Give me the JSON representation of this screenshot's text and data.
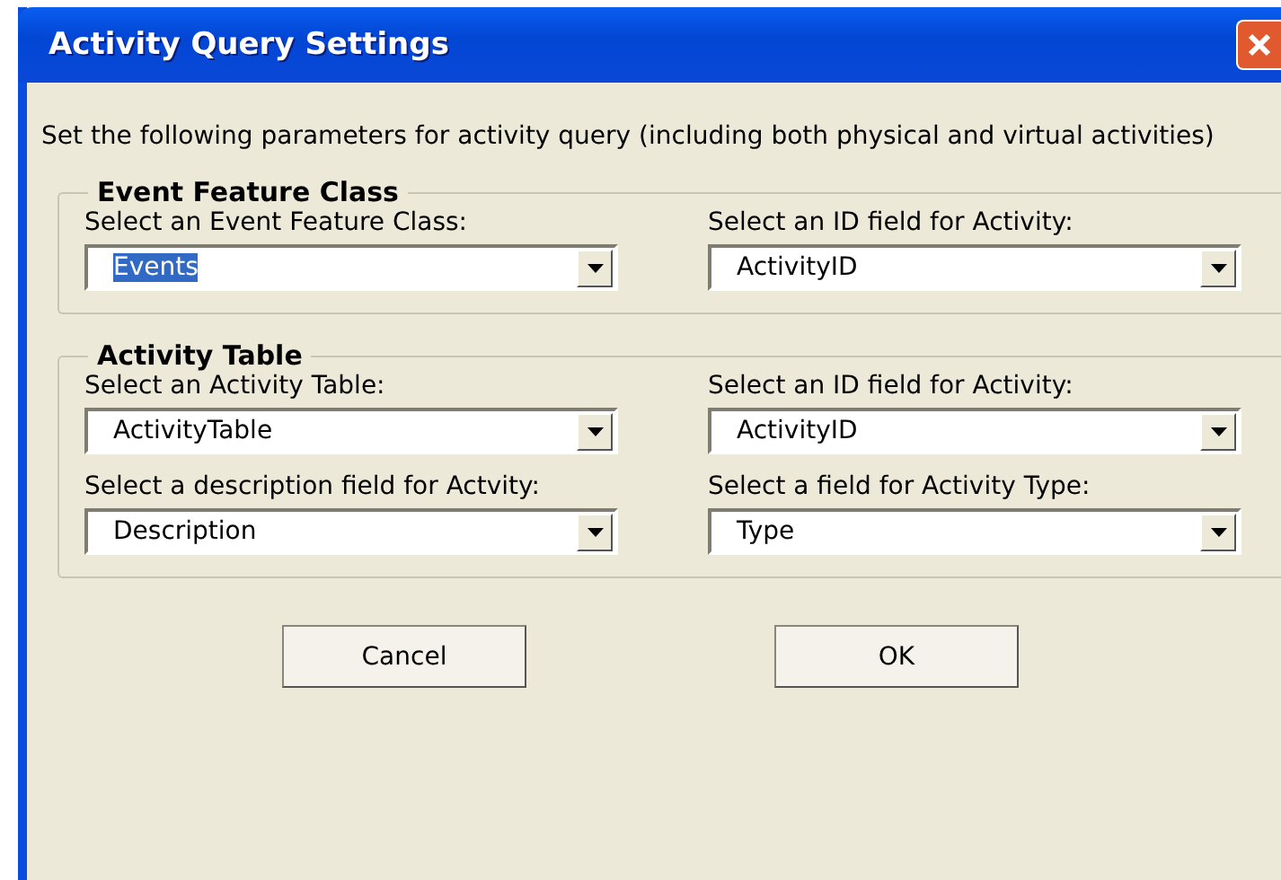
{
  "window": {
    "title": "Activity Query Settings"
  },
  "intro": "Set the following parameters for activity query (including both physical and virtual activities)",
  "groups": [
    {
      "title": "Event Feature Class",
      "fields": [
        {
          "label": "Select an Event Feature Class:",
          "value": "Events",
          "text_selected": true
        },
        {
          "label": "Select an ID field for Activity:",
          "value": "ActivityID",
          "text_selected": false
        }
      ]
    },
    {
      "title": "Activity Table",
      "fields": [
        {
          "label": "Select an Activity Table:",
          "value": "ActivityTable",
          "text_selected": false
        },
        {
          "label": "Select an ID field for Activity:",
          "value": "ActivityID",
          "text_selected": false
        },
        {
          "label": "Select a description field for Actvity:",
          "value": "Description",
          "text_selected": false
        },
        {
          "label": "Select a field for Activity Type:",
          "value": "Type",
          "text_selected": false
        }
      ]
    }
  ],
  "buttons": [
    "Cancel",
    "OK"
  ]
}
